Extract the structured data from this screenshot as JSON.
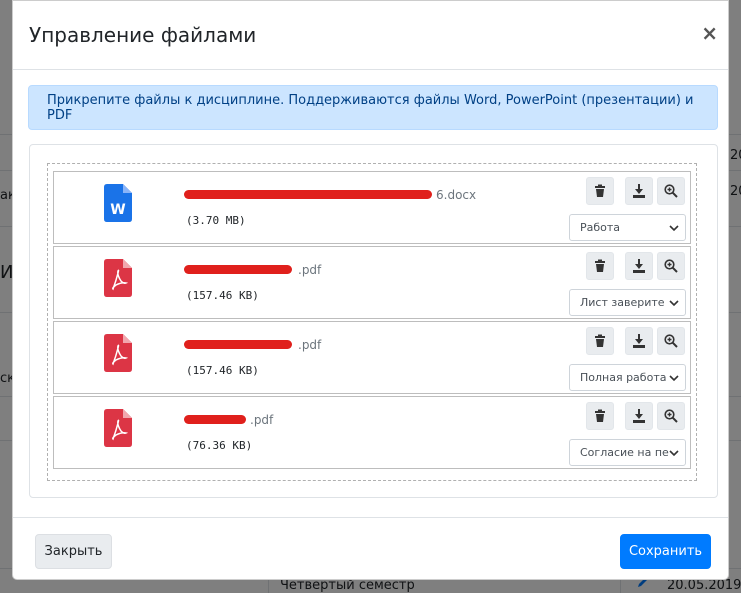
{
  "modal": {
    "title": "Управление файлами",
    "close_symbol": "×",
    "info": "Прикрепите файлы к дисциплине. Поддерживаются файлы Word, PowerPoint (презентации) и PDF",
    "files": [
      {
        "icon": "word-file-icon",
        "name_suffix": "6.docx",
        "size": "(3.70 MB)",
        "type": "Работа"
      },
      {
        "icon": "pdf-file-icon",
        "name_suffix": ".pdf",
        "size": "(157.46 KB)",
        "type": "Лист заверите"
      },
      {
        "icon": "pdf-file-icon",
        "name_suffix": ".pdf",
        "size": "(157.46 KB)",
        "type": "Полная работа"
      },
      {
        "icon": "pdf-file-icon",
        "name_suffix": ".pdf",
        "size": "(76.36 KB)",
        "type": "Согласие на пе"
      }
    ],
    "footer": {
      "close_label": "Закрыть",
      "save_label": "Сохранить"
    }
  },
  "background": {
    "frag_20_a": "20",
    "frag_20_b": "20",
    "frag_ak": "ак",
    "frag_i": "И.",
    "frag_ck": "ск",
    "semester": "Четвертый семестр",
    "date": "20.05.2019"
  },
  "colors": {
    "primary": "#007bff",
    "word_icon": "#1a73e8",
    "pdf_icon": "#dc3545",
    "alert_bg": "#cce5ff",
    "redaction": "#e0201c"
  }
}
